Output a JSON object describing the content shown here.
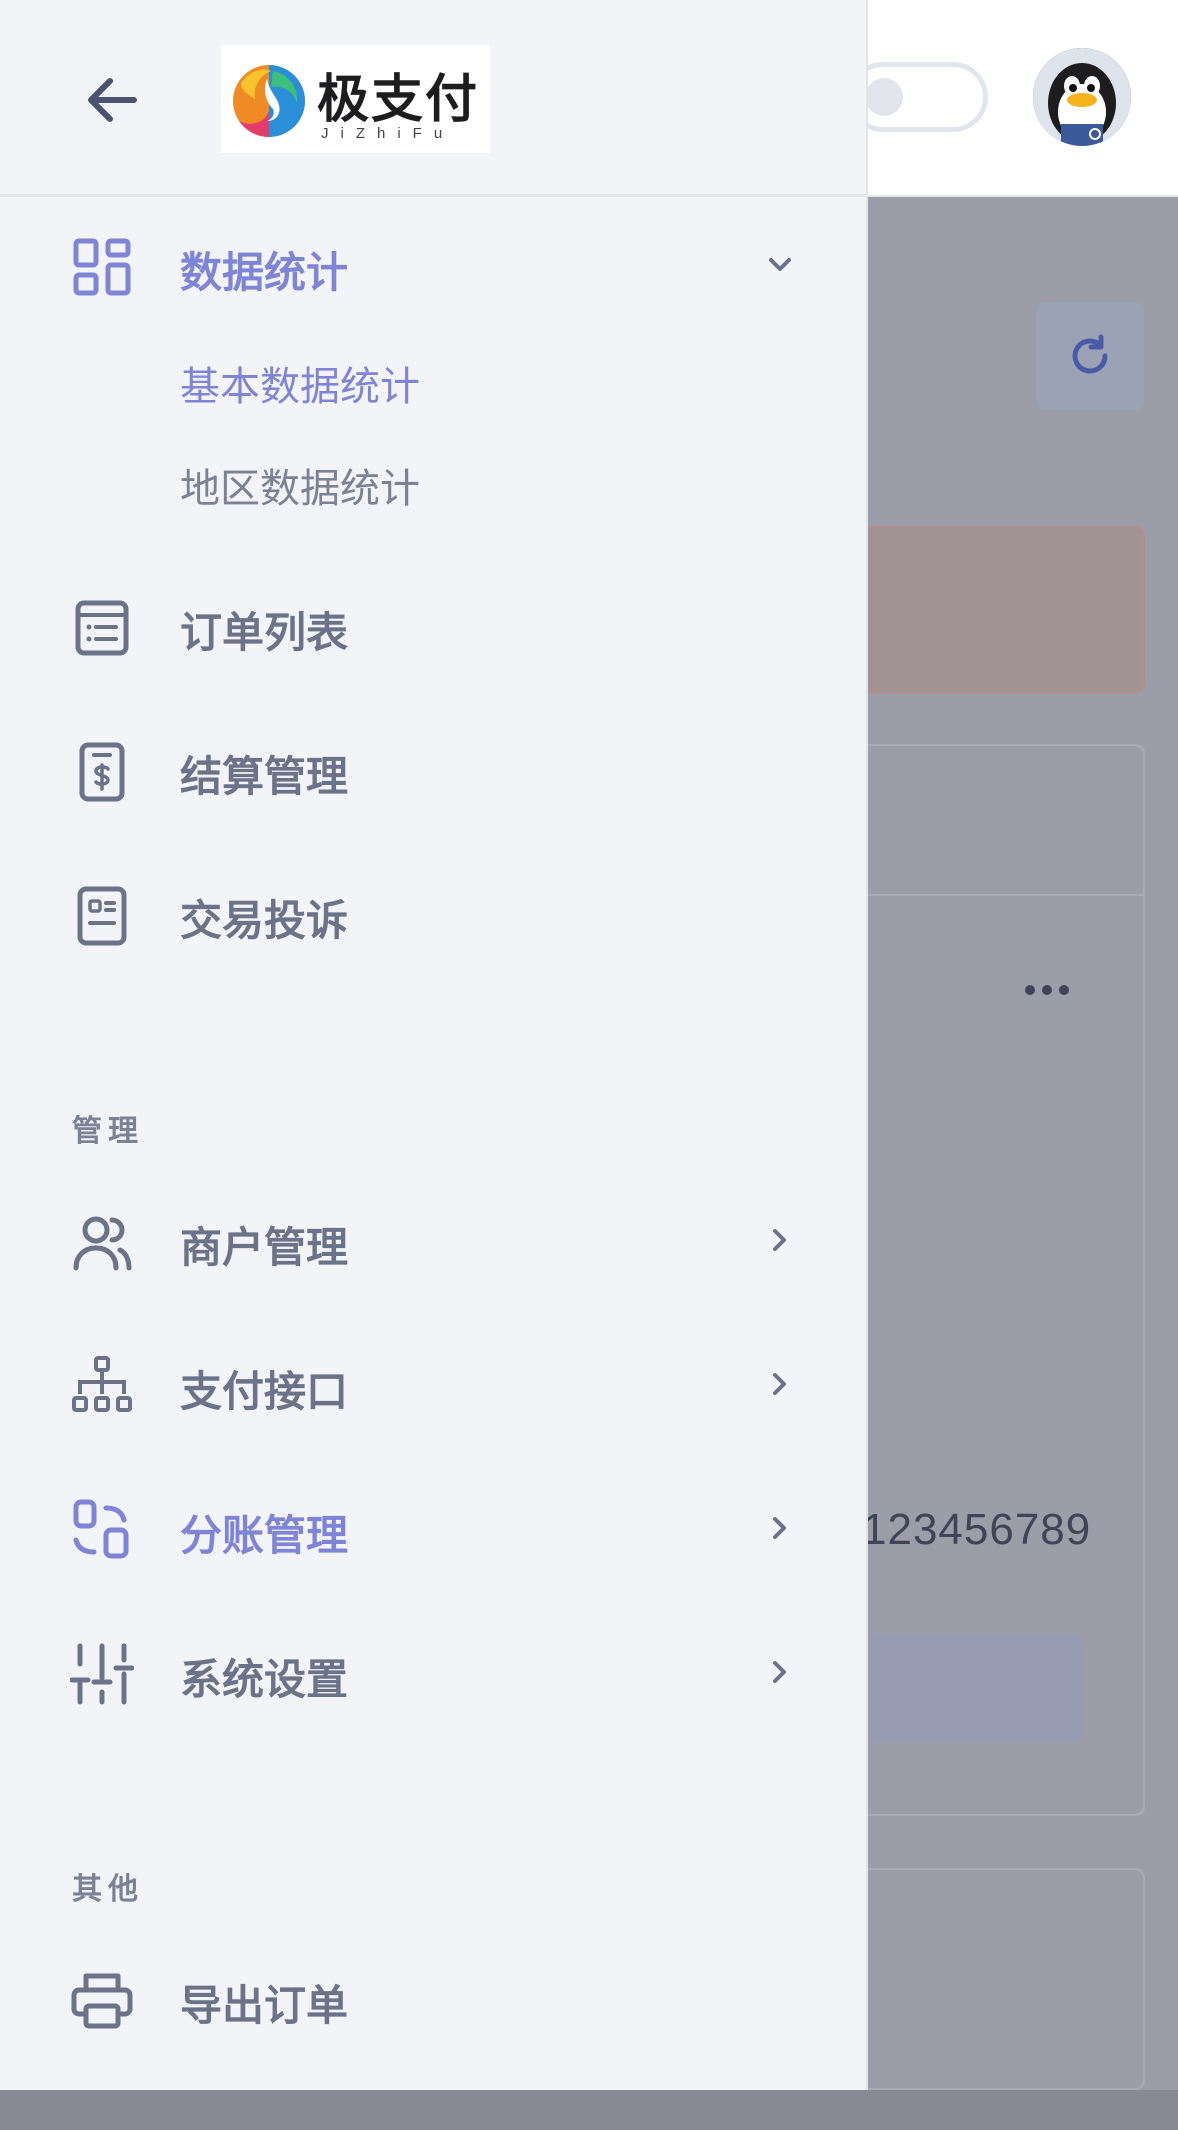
{
  "header": {
    "logo_text": "极支付",
    "logo_sub": "JiZhiFu"
  },
  "background": {
    "phone_text": "123456789"
  },
  "menu": {
    "data_stats": {
      "label": "数据统计",
      "sub_items": [
        {
          "label": "基本数据统计",
          "active": true
        },
        {
          "label": "地区数据统计",
          "active": false
        }
      ]
    },
    "items": [
      {
        "label": "订单列表",
        "icon": "list-doc-icon"
      },
      {
        "label": "结算管理",
        "icon": "dollar-doc-icon"
      },
      {
        "label": "交易投诉",
        "icon": "complaint-doc-icon"
      }
    ],
    "section_manage": "管理",
    "manage_items": [
      {
        "label": "商户管理",
        "icon": "users-icon"
      },
      {
        "label": "支付接口",
        "icon": "hierarchy-icon"
      },
      {
        "label": "分账管理",
        "icon": "split-icon",
        "active": true
      },
      {
        "label": "系统设置",
        "icon": "sliders-icon"
      }
    ],
    "section_other": "其他",
    "other_items": [
      {
        "label": "导出订单",
        "icon": "printer-icon"
      }
    ]
  },
  "colors": {
    "accent": "#7f84d6",
    "text": "#6c7288",
    "drawer_bg": "#f3f4f8"
  }
}
